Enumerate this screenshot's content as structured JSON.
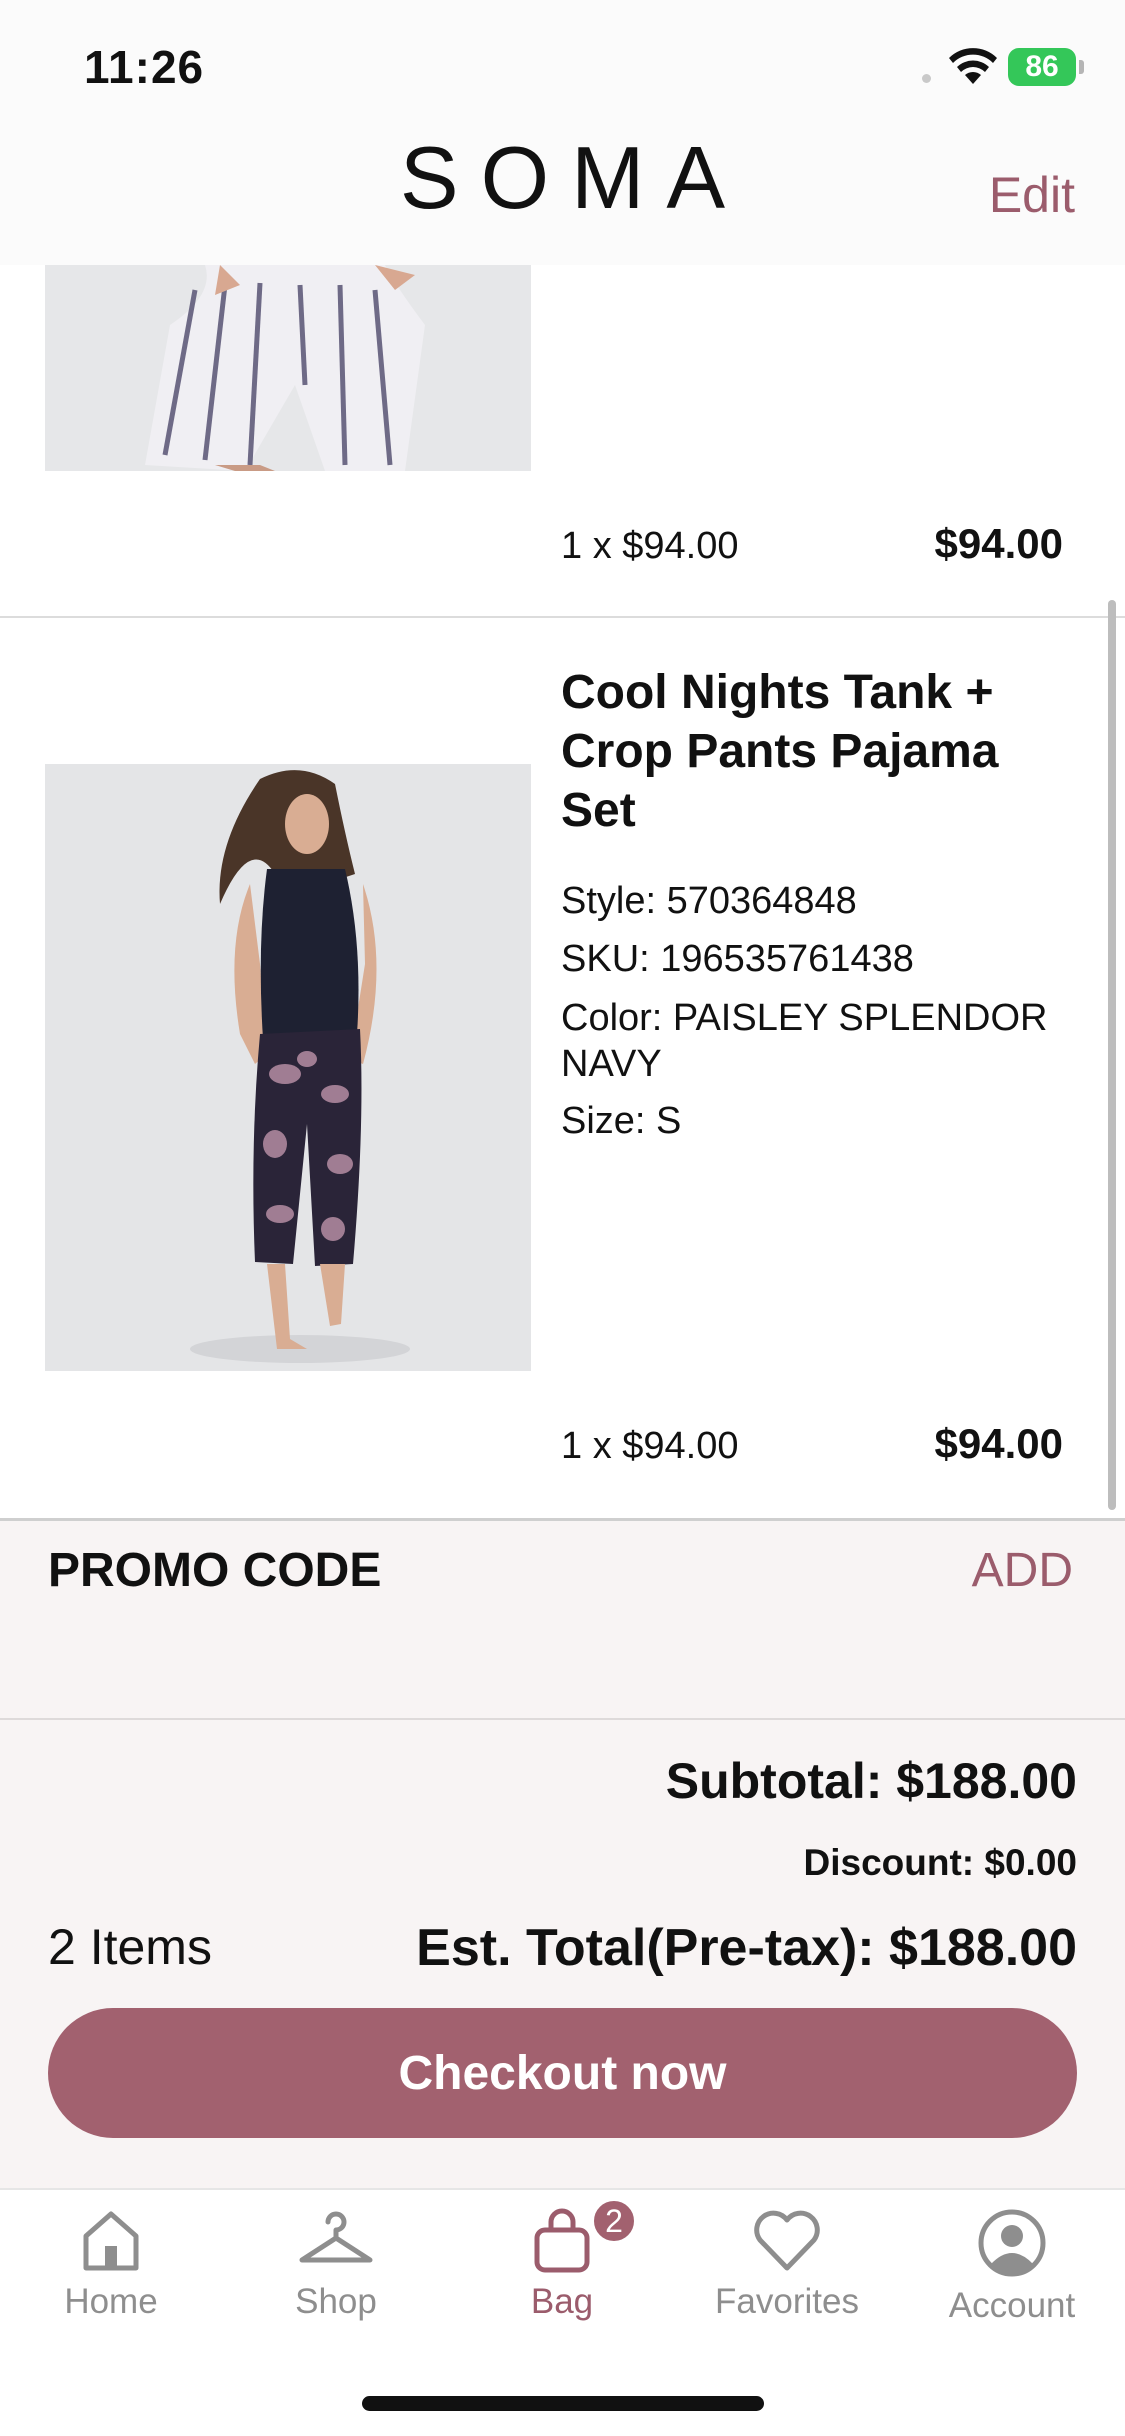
{
  "status_bar": {
    "time": "11:26",
    "battery": "86"
  },
  "header": {
    "logo": "SOMA",
    "edit_label": "Edit"
  },
  "cart": {
    "items": [
      {
        "qty_text": "1 x $94.00",
        "price": "$94.00"
      },
      {
        "title": "Cool Nights Tank + Crop Pants Pajama Set",
        "style": "Style: 570364848",
        "sku": "SKU: 196535761438",
        "color": "Color: PAISLEY SPLENDOR NAVY",
        "size": "Size: S",
        "qty_text": "1 x $94.00",
        "price": "$94.00"
      }
    ]
  },
  "promo": {
    "label": "PROMO CODE",
    "action": "ADD"
  },
  "summary": {
    "subtotal": "Subtotal: $188.00",
    "discount": "Discount: $0.00",
    "items_count": "2 Items",
    "est_total": "Est. Total(Pre-tax): $188.00",
    "checkout_label": "Checkout now"
  },
  "tabbar": {
    "tabs": [
      {
        "label": "Home",
        "icon": "home-icon"
      },
      {
        "label": "Shop",
        "icon": "hanger-icon"
      },
      {
        "label": "Bag",
        "icon": "bag-icon",
        "active": true,
        "badge": "2"
      },
      {
        "label": "Favorites",
        "icon": "heart-icon"
      },
      {
        "label": "Account",
        "icon": "account-icon"
      }
    ]
  },
  "colors": {
    "accent": "#a2616f",
    "accent_text": "#9b5c6c",
    "summary_bg": "#f8f4f4"
  }
}
